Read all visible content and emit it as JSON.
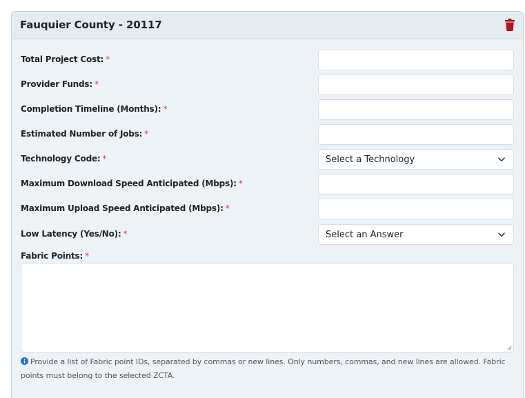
{
  "card": {
    "title": "Fauquier County - 20117",
    "delete_icon": "trash-icon"
  },
  "form": {
    "required_marker": "*",
    "fields": [
      {
        "label": "Total Project Cost:",
        "type": "text",
        "value": ""
      },
      {
        "label": "Provider Funds:",
        "type": "text",
        "value": ""
      },
      {
        "label": "Completion Timeline (Months):",
        "type": "text",
        "value": ""
      },
      {
        "label": "Estimated Number of Jobs:",
        "type": "text",
        "value": ""
      },
      {
        "label": "Technology Code:",
        "type": "select",
        "selected": "Select a Technology"
      },
      {
        "label": "Maximum Download Speed Anticipated (Mbps):",
        "type": "text",
        "value": ""
      },
      {
        "label": "Maximum Upload Speed Anticipated (Mbps):",
        "type": "text",
        "value": ""
      },
      {
        "label": "Low Latency (Yes/No):",
        "type": "select",
        "selected": "Select an Answer"
      }
    ],
    "fabric": {
      "label": "Fabric Points:",
      "value": "",
      "help": "Provide a list of Fabric point IDs, separated by commas or new lines. Only numbers, commas, and new lines are allowed. Fabric points must belong to the selected ZCTA.",
      "help_icon": "info-circle-icon"
    }
  },
  "colors": {
    "required": "#e0344a",
    "delete": "#b3141b",
    "info": "#1f6fd6"
  }
}
